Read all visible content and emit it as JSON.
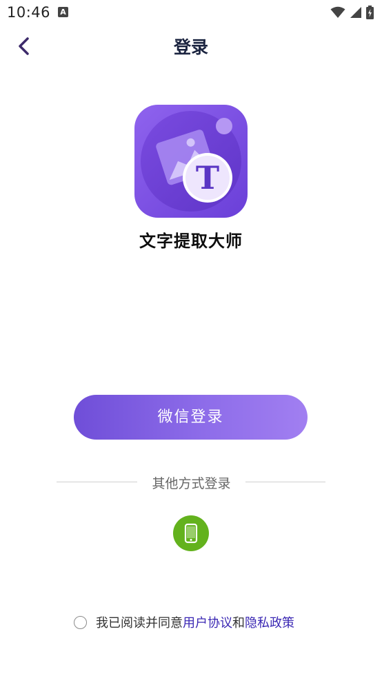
{
  "status_bar": {
    "time": "10:46",
    "notification_badge": "A",
    "icons": [
      "wifi-icon",
      "signal-icon",
      "battery-charging-icon"
    ]
  },
  "header": {
    "title": "登录",
    "back_icon": "chevron-left-icon"
  },
  "app": {
    "name": "文字提取大师",
    "icon_letter": "T"
  },
  "login": {
    "wechat_button": "微信登录",
    "other_methods": "其他方式登录",
    "phone_icon": "phone-icon"
  },
  "agreement": {
    "prefix": "我已阅读并同意",
    "user_agreement": "用户协议",
    "and": "和",
    "privacy_policy": "隐私政策"
  },
  "colors": {
    "accent": "#7a58de",
    "phone_green": "#63b21d",
    "link": "#3a27b3"
  }
}
